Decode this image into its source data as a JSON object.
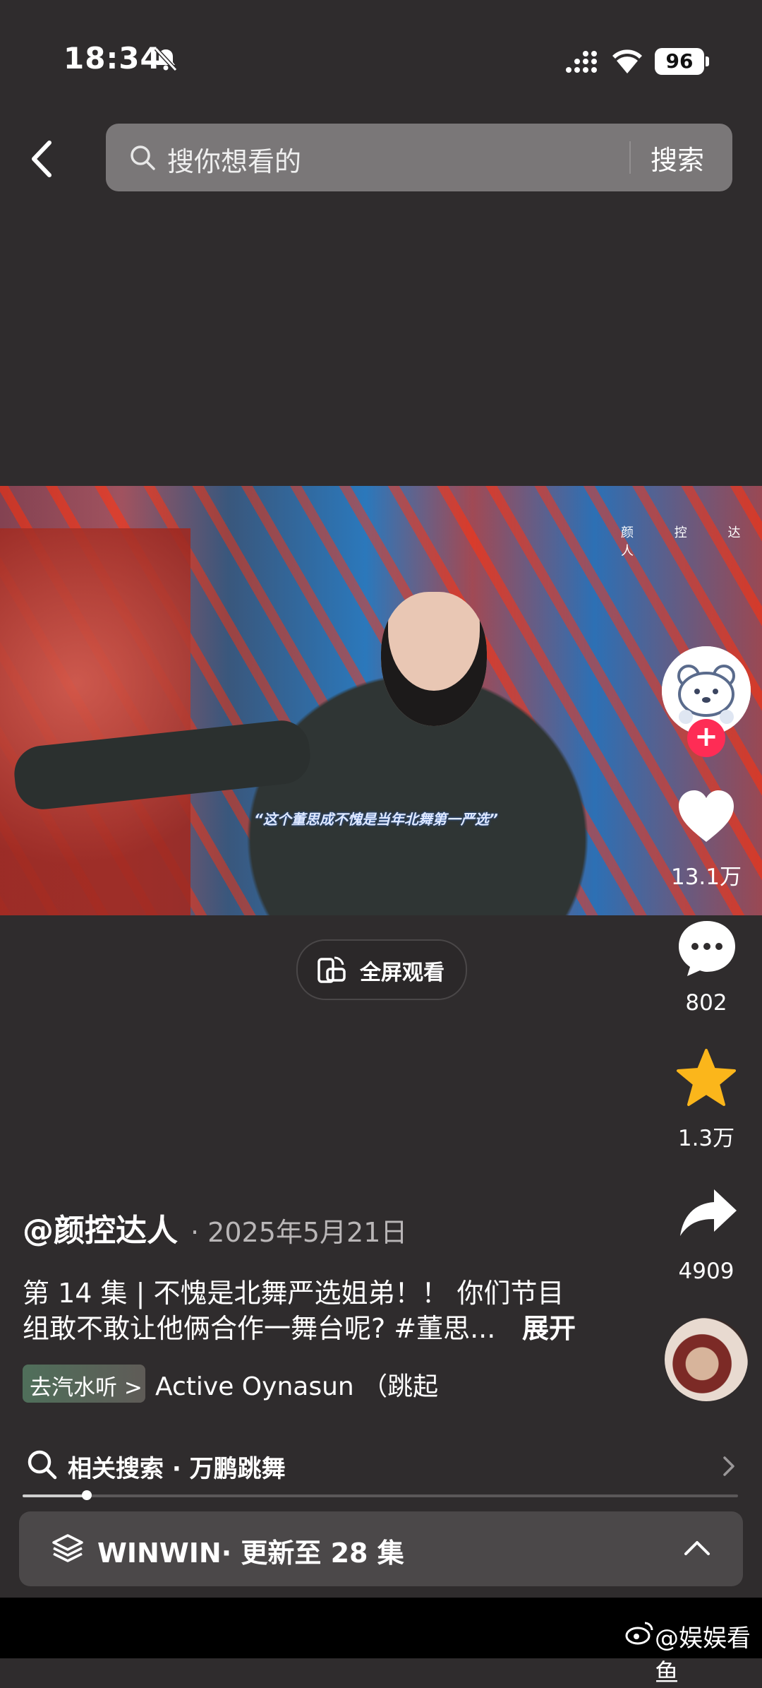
{
  "status_bar": {
    "time": "18:34",
    "battery": "96",
    "icons": [
      "bell-muted-icon",
      "signal-icon",
      "wifi-icon",
      "battery-icon"
    ]
  },
  "header": {
    "back_icon": "chevron-left-icon",
    "search_placeholder": "搜你想看的",
    "search_button": "搜索"
  },
  "video": {
    "watermark": "颜 控 达 人",
    "caption": "“这个董思成不愧是当年北舞第一严选”",
    "fullscreen_label": "全屏观看"
  },
  "actions": {
    "like_count": "13.1万",
    "comment_count": "802",
    "favorite_count": "1.3万",
    "share_count": "4909",
    "follow_symbol": "+"
  },
  "post": {
    "author": "@颜控达人",
    "date": "· 2025年5月21日",
    "desc_line1": "第 14 集 | 不愧是北舞严选姐弟！！ 你们节目",
    "desc_line2": "组敢不敢让他俩合作一舞台呢? #董思...",
    "expand": "展开",
    "music_chip": "去汽水听 >",
    "music_track": "Active   Oynasun （跳起"
  },
  "related": {
    "label": "相关搜索 · 万鹏跳舞"
  },
  "progress": {
    "fraction": 0.09
  },
  "series": {
    "label": "WINWIN· 更新至 28 集"
  },
  "footer": {
    "credit": "@娱娱看鱼"
  },
  "colors": {
    "background": "#2f2c2d",
    "follow": "#fe2c55",
    "star": "#fbb61b",
    "search_box": "#7a7778"
  }
}
